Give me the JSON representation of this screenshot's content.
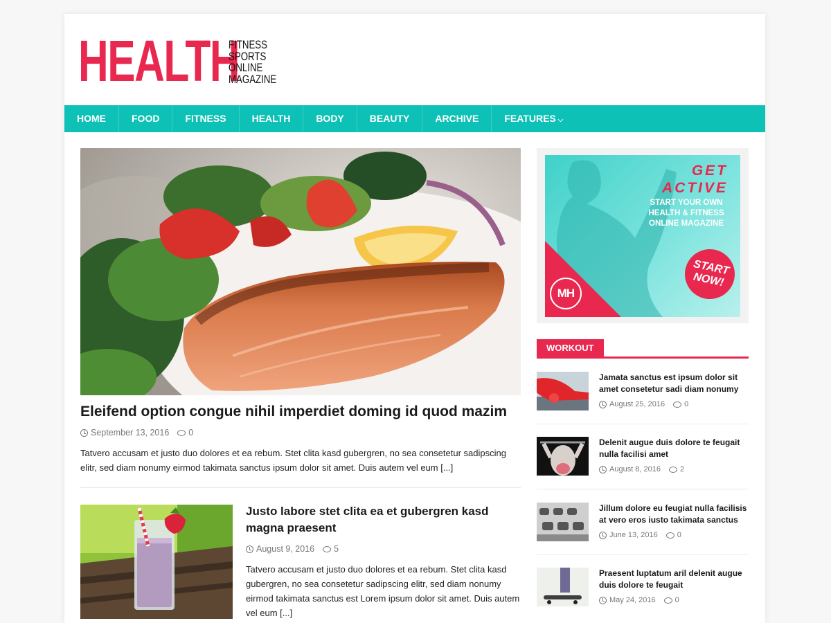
{
  "logo": {
    "main": "HEALTH",
    "lines": [
      "FITNESS",
      "SPORTS",
      "ONLINE",
      "MAGAZINE"
    ]
  },
  "nav": [
    {
      "label": "HOME"
    },
    {
      "label": "FOOD"
    },
    {
      "label": "FITNESS"
    },
    {
      "label": "HEALTH"
    },
    {
      "label": "BODY"
    },
    {
      "label": "BEAUTY"
    },
    {
      "label": "ARCHIVE"
    },
    {
      "label": "FEATURES"
    }
  ],
  "featured": {
    "title": "Eleifend option congue nihil imperdiet doming id quod mazim",
    "date": "September 13, 2016",
    "comments": "0",
    "excerpt": "Tatvero accusam et justo duo dolores et ea rebum. Stet clita kasd gubergren, no sea consetetur sadipscing elitr, sed diam nonumy eirmod takimata sanctus ipsum dolor sit amet. Duis autem vel eum [...]"
  },
  "post2": {
    "title": "Justo labore stet clita ea et gubergren kasd magna praesent",
    "date": "August 9, 2016",
    "comments": "5",
    "excerpt": "Tatvero accusam et justo duo dolores et ea rebum. Stet clita kasd gubergren, no sea consetetur sadipscing elitr, sed diam nonumy eirmod takimata sanctus est Lorem ipsum dolor sit amet. Duis autem vel eum [...]"
  },
  "ad": {
    "line1": "GET",
    "line2": "ACTIVE",
    "sub": "START YOUR OWN HEALTH & FITNESS ONLINE MAGAZINE",
    "badge": "MH",
    "cta": "START NOW!"
  },
  "workout": {
    "title": "WORKOUT",
    "items": [
      {
        "title": "Jamata sanctus est ipsum dolor sit amet consetetur sadi diam nonumy",
        "date": "August 25, 2016",
        "comments": "0"
      },
      {
        "title": "Delenit augue duis dolore te feugait nulla facilisi amet",
        "date": "August 8, 2016",
        "comments": "2"
      },
      {
        "title": "Jillum dolore eu feugiat nulla facilisis at vero eros iusto takimata sanctus",
        "date": "June 13, 2016",
        "comments": "0"
      },
      {
        "title": "Praesent luptatum aril delenit augue duis dolore te feugait",
        "date": "May 24, 2016",
        "comments": "0"
      }
    ]
  },
  "colors": {
    "brand": "#e8284e",
    "nav": "#0dc1b6"
  }
}
